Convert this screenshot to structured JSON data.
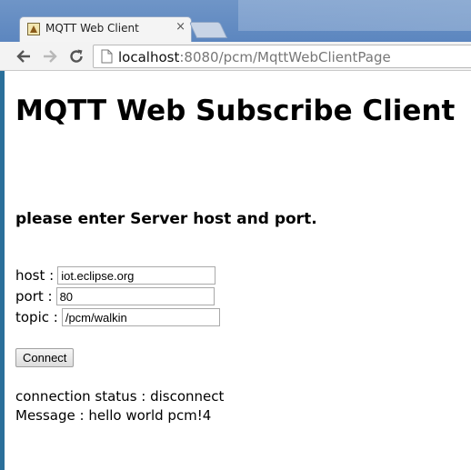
{
  "browser": {
    "tab_title": "MQTT Web Client",
    "tab_close": "×",
    "url_host": "localhost",
    "url_rest": ":8080/pcm/MqttWebClientPage"
  },
  "page": {
    "title": "MQTT Web Subscribe Client",
    "instruction": "please enter Server host and port.",
    "form": {
      "host_label": "host :",
      "host_value": "iot.eclipse.org",
      "port_label": "port :",
      "port_value": "80",
      "topic_label": "topic :",
      "topic_value": "/pcm/walkin",
      "connect_label": "Connect"
    },
    "status": {
      "connection": "connection status : disconnect",
      "message": "Message : hello world pcm!4"
    }
  }
}
